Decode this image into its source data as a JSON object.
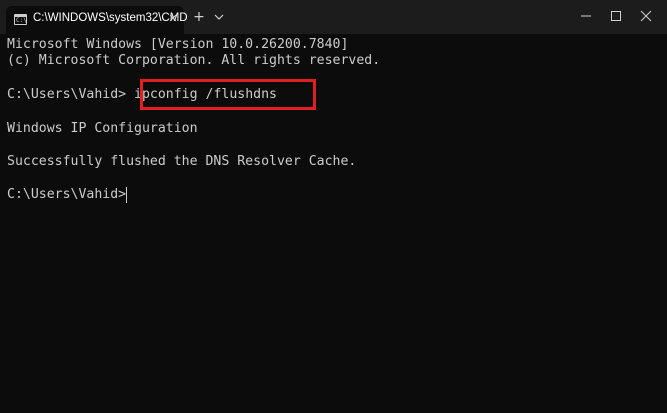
{
  "tab": {
    "title": "C:\\WINDOWS\\system32\\CMD",
    "icon": "cmd-icon",
    "icon_glyph": "C:\\"
  },
  "titlebar": {
    "close_tab_glyph": "✕",
    "new_tab_glyph": "+",
    "dropdown_icon": "chevron-down-icon",
    "minimize_icon": "minimize-icon",
    "maximize_icon": "maximize-icon",
    "close_icon": "close-icon"
  },
  "terminal": {
    "version_line": "Microsoft Windows [Version 10.0.26200.7840]",
    "copyright_line": "(c) Microsoft Corporation. All rights reserved.",
    "prompt": "C:\\Users\\Vahid>",
    "command": "ipconfig /flushdns",
    "output_heading": "Windows IP Configuration",
    "output_result": "Successfully flushed the DNS Resolver Cache.",
    "final_prompt": "C:\\Users\\Vahid>"
  },
  "colors": {
    "terminal_background": "#0c0c0c",
    "titlebar_background": "#1c1c1c",
    "text": "#cccccc",
    "highlight_border": "#e02020"
  }
}
